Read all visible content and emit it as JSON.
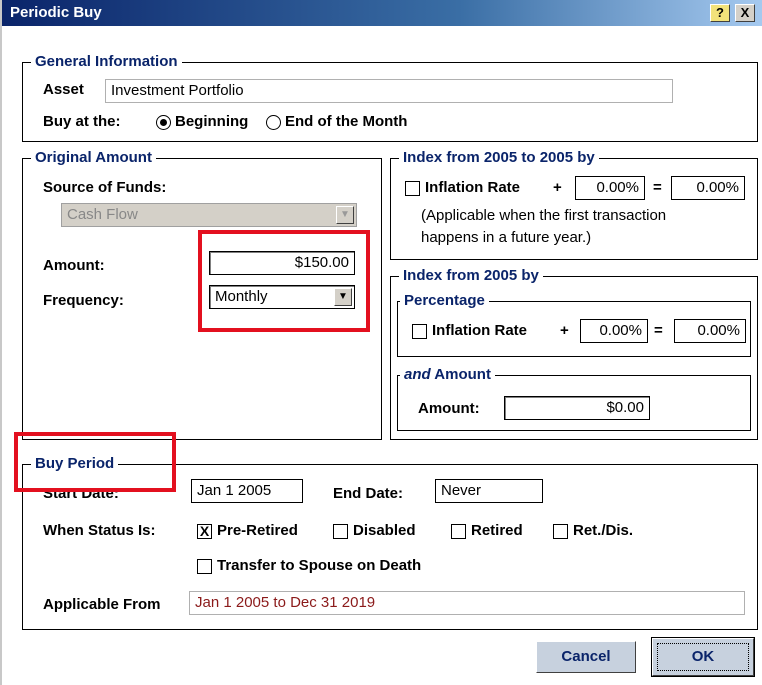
{
  "window": {
    "title": "Periodic Buy",
    "help_label": "?",
    "close_label": "X"
  },
  "general": {
    "legend": "General Information",
    "asset_label": "Asset",
    "asset_value": "Investment Portfolio",
    "buy_at_label": "Buy at the:",
    "options": [
      "Beginning",
      "End of the Month"
    ],
    "selected": "Beginning"
  },
  "original": {
    "legend": "Original Amount",
    "source_label": "Source of Funds:",
    "source_value": "Cash Flow",
    "amount_label": "Amount:",
    "amount_value": "$150.00",
    "frequency_label": "Frequency:",
    "frequency_value": "Monthly"
  },
  "index_2005_to_2005": {
    "legend": "Index from  2005  to  2005  by",
    "inflation_label": "Inflation Rate",
    "plus": "+",
    "rate": "0.00%",
    "equals": "=",
    "result": "0.00%",
    "note_line1": "(Applicable when the first transaction",
    "note_line2": "happens in a future year.)"
  },
  "index_2005": {
    "legend": "Index from 2005 by",
    "percentage_legend": "Percentage",
    "inflation_label": "Inflation Rate",
    "plus": "+",
    "rate": "0.00%",
    "equals": "=",
    "result": "0.00%",
    "and_legend": "and",
    "amount_legend": " Amount",
    "amount_label": "Amount:",
    "amount_value": "$0.00"
  },
  "buy_period": {
    "legend": "Buy Period",
    "start_label": "Start Date:",
    "start_value": "Jan 1 2005",
    "end_label": "End Date:",
    "end_value": "Never",
    "status_label": "When Status Is:",
    "statuses": [
      {
        "label": "Pre-Retired",
        "checked": true
      },
      {
        "label": "Disabled",
        "checked": false
      },
      {
        "label": "Retired",
        "checked": false
      },
      {
        "label": "Ret./Dis.",
        "checked": false
      }
    ],
    "check_mark": "X",
    "transfer_label": "Transfer to Spouse on Death",
    "applicable_label": "Applicable From",
    "applicable_value": "Jan 1 2005 to Dec 31 2019"
  },
  "buttons": {
    "cancel": "Cancel",
    "ok": "OK"
  },
  "icons": {
    "combo_arrow": "triangle-down-icon"
  },
  "colors": {
    "legend": "#0a246a",
    "highlight": "#e3101f",
    "applicable_text": "#8b1a1a"
  }
}
